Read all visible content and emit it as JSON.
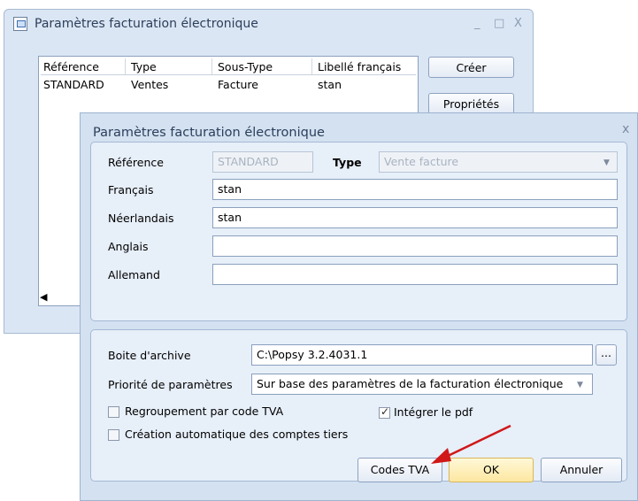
{
  "back_window": {
    "title": "Paramètres facturation électronique",
    "controls": {
      "minimize": "_",
      "maximize": "□",
      "close": "X"
    },
    "table": {
      "columns": [
        "Référence",
        "Type",
        "Sous-Type",
        "Libellé français"
      ],
      "rows": [
        [
          "STANDARD",
          "Ventes",
          "Facture",
          "stan"
        ]
      ]
    },
    "buttons": {
      "create": "Créer",
      "properties": "Propriétés"
    }
  },
  "dialog": {
    "title": "Paramètres facturation électronique",
    "close": "x",
    "reference": {
      "label": "Référence",
      "value": "STANDARD"
    },
    "type": {
      "label": "Type",
      "value": "Vente facture"
    },
    "french": {
      "label": "Français",
      "value": "stan"
    },
    "dutch": {
      "label": "Néerlandais",
      "value": "stan"
    },
    "english": {
      "label": "Anglais",
      "value": ""
    },
    "german": {
      "label": "Allemand",
      "value": ""
    },
    "archive": {
      "label": "Boite d'archive",
      "value": "C:\\Popsy 3.2.4031.1",
      "browse": "..."
    },
    "priority": {
      "label": "Priorité de paramètres",
      "value": "Sur base des paramètres de la facturation électronique"
    },
    "checkboxes": {
      "vat_grouping": {
        "label": "Regroupement par code TVA",
        "checked": false
      },
      "integrate_pdf": {
        "label": "Intégrer le pdf",
        "checked": true
      },
      "auto_accounts": {
        "label": "Création automatique des comptes tiers",
        "checked": false
      }
    },
    "buttons": {
      "vat_codes": "Codes TVA",
      "ok": "OK",
      "cancel": "Annuler"
    }
  },
  "annotation": {
    "arrow_color": "#d01818"
  }
}
